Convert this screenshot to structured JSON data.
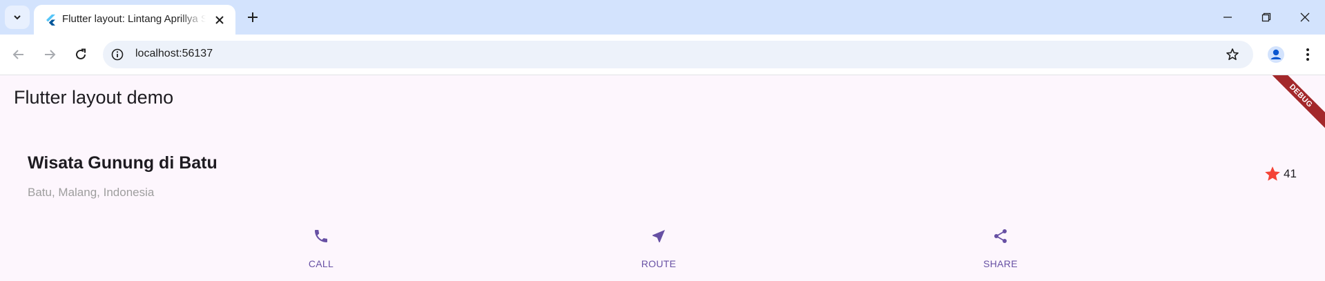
{
  "browser": {
    "tab_title": "Flutter layout: Lintang Aprillya S",
    "url": "localhost:56137"
  },
  "app": {
    "title": "Flutter layout demo",
    "debug_label": "DEBUG"
  },
  "place": {
    "name": "Wisata Gunung di Batu",
    "location": "Batu, Malang, Indonesia",
    "rating_count": "41"
  },
  "actions": [
    {
      "label": "CALL",
      "icon": "phone-icon"
    },
    {
      "label": "ROUTE",
      "icon": "near-me-icon"
    },
    {
      "label": "SHARE",
      "icon": "share-icon"
    }
  ],
  "colors": {
    "accent": "#6750a4",
    "star": "#f44336",
    "background": "#fdf6fd",
    "tabstrip": "#d3e3fd"
  }
}
